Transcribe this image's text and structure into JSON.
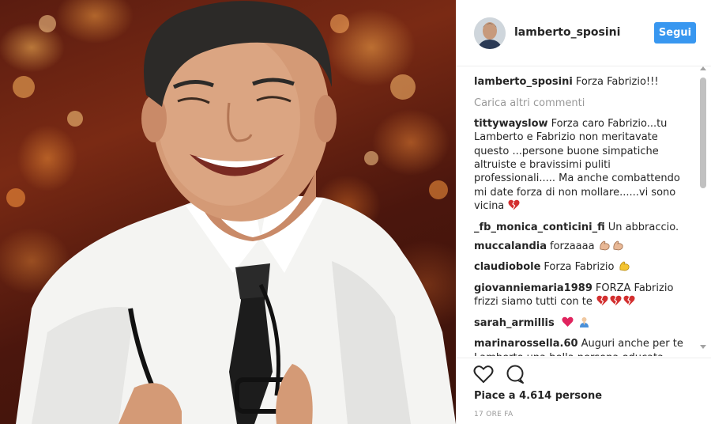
{
  "post": {
    "author": "lamberto_sposini",
    "follow_label": "Segui",
    "caption_user": "lamberto_sposini",
    "caption_text": "Forza Fabrizio!!!",
    "load_more_label": "Carica altri commenti",
    "comments": [
      {
        "user": "tittywayslow",
        "text": "Forza caro Fabrizio...tu Lamberto e Fabrizio non meritavate questo ...persone buone simpatiche altruiste e bravissimi puliti professionali..... Ma anche combattendo mi date forza di non mollare......vi sono vicina",
        "emoji": [
          "broken-heart-icon"
        ]
      },
      {
        "user": "_fb_monica_conticini_fi",
        "text": "Un abbraccio.",
        "emoji": []
      },
      {
        "user": "muccalandia",
        "text": "forzaaaa",
        "emoji": [
          "flexed-biceps-icon",
          "flexed-biceps-icon"
        ]
      },
      {
        "user": "claudiobole",
        "text": "Forza Fabrizio",
        "emoji": [
          "flexed-biceps-icon"
        ]
      },
      {
        "user": "giovanniemaria1989",
        "text": "FORZA Fabrizio frizzi siamo tutti con te",
        "emoji": [
          "broken-heart-icon",
          "broken-heart-icon",
          "broken-heart-icon"
        ]
      },
      {
        "user": "sarah_armillis",
        "text": "",
        "emoji": [
          "red-heart-icon",
          "person-praying-icon"
        ]
      },
      {
        "user": "marinarossella.60",
        "text": "Auguri anche per te Lamberto una bella persona educata gentile spero che non continuano a dimenticarti bella il tuo messaggio a",
        "emoji": []
      }
    ],
    "likes_text": "Piace a 4.614 persone",
    "time_text": "17 ORE FA",
    "icons": {
      "like": "heart-outline-icon",
      "comment": "comment-bubble-icon"
    },
    "colors": {
      "follow_button": "#3897f0",
      "muted": "#999999",
      "heart_emoji": "#d32f2f"
    }
  }
}
